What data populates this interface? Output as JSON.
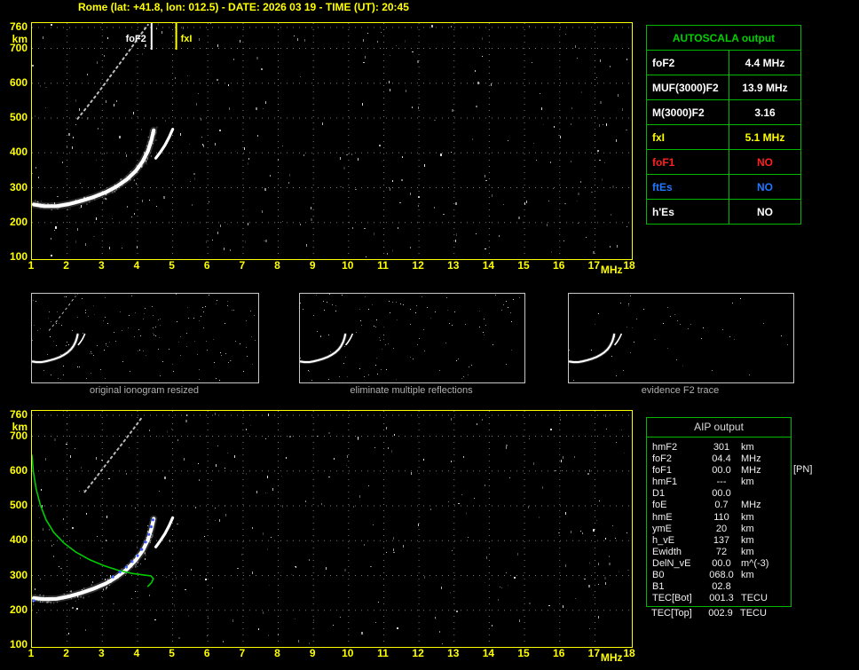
{
  "title": "Rome (lat: +41.8, lon: 012.5) - DATE: 2026 03 19 - TIME (UT): 20:45",
  "colors": {
    "background": "#000000",
    "axis_labels": "#ffff00",
    "plot_border": "#ffff00",
    "grid": "#787878",
    "echo_trace": "#ffffff",
    "profile_curve": "#00cc00",
    "fitted_trace": "#3a5bff",
    "table_border": "#00b800",
    "table_header_green": "#00d000",
    "fxI_yellow": "#ffff00",
    "foF1_red": "#ff2020",
    "ftEs_blue": "#2277ff",
    "caption_gray": "#b0b0b0",
    "thumbnail_border": "#c8c8c8"
  },
  "chart_data": [
    {
      "type": "scatter",
      "title": "autoscaled ionogram",
      "xlabel": "MHz",
      "ylabel": "km",
      "xlim": [
        1,
        18
      ],
      "ylim": [
        100,
        760
      ],
      "xticks": [
        1,
        2,
        3,
        4,
        5,
        6,
        7,
        8,
        9,
        10,
        11,
        12,
        13,
        14,
        15,
        16,
        17,
        18
      ],
      "yticks": [
        760,
        700,
        600,
        500,
        400,
        300,
        200,
        100
      ],
      "grid": true,
      "markers": [
        {
          "label": "foF2",
          "f": 4.4,
          "color": "#ffffff",
          "align": "left"
        },
        {
          "label": "fxI",
          "f": 5.1,
          "color": "#ffff00",
          "align": "right"
        }
      ],
      "series": [
        {
          "name": "F2-trace",
          "style": "thick",
          "color": "#ffffff",
          "points": [
            [
              1.05,
              252
            ],
            [
              1.35,
              247
            ],
            [
              1.7,
              247
            ],
            [
              2.05,
              253
            ],
            [
              2.4,
              262
            ],
            [
              2.75,
              273
            ],
            [
              3.1,
              287
            ],
            [
              3.4,
              303
            ],
            [
              3.7,
              324
            ],
            [
              3.95,
              348
            ],
            [
              4.15,
              376
            ],
            [
              4.3,
              406
            ],
            [
              4.4,
              438
            ],
            [
              4.46,
              465
            ]
          ]
        },
        {
          "name": "x-mode-tail",
          "style": "medium",
          "color": "#ffffff",
          "points": [
            [
              4.52,
              385
            ],
            [
              4.65,
              402
            ],
            [
              4.78,
              422
            ],
            [
              4.9,
              445
            ],
            [
              5.0,
              468
            ]
          ]
        },
        {
          "name": "second-reflection",
          "style": "dotted",
          "color": "#e0e0e0",
          "points": [
            [
              2.3,
              498
            ],
            [
              2.55,
              530
            ],
            [
              2.8,
              562
            ],
            [
              3.05,
              596
            ],
            [
              3.3,
              630
            ],
            [
              3.55,
              664
            ],
            [
              3.8,
              698
            ],
            [
              4.0,
              727
            ],
            [
              4.18,
              752
            ],
            [
              4.3,
              768
            ]
          ]
        }
      ],
      "noise": {
        "count": 260,
        "seed": 12345
      }
    },
    {
      "type": "scatter",
      "title": "ionogram with AIP electron density profile",
      "xlabel": "MHz",
      "ylabel": "km",
      "xlim": [
        1,
        18
      ],
      "ylim": [
        100,
        760
      ],
      "xticks": [
        1,
        2,
        3,
        4,
        5,
        6,
        7,
        8,
        9,
        10,
        11,
        12,
        13,
        14,
        15,
        16,
        17,
        18
      ],
      "yticks": [
        760,
        700,
        600,
        500,
        400,
        300,
        200,
        100
      ],
      "grid": true,
      "markers": [],
      "series": [
        {
          "name": "F2-trace",
          "style": "thick",
          "color": "#ffffff",
          "points": [
            [
              1.05,
              235
            ],
            [
              1.35,
              232
            ],
            [
              1.7,
              233
            ],
            [
              2.05,
              240
            ],
            [
              2.4,
              250
            ],
            [
              2.75,
              262
            ],
            [
              3.1,
              277
            ],
            [
              3.4,
              295
            ],
            [
              3.7,
              318
            ],
            [
              3.95,
              344
            ],
            [
              4.15,
              372
            ],
            [
              4.3,
              403
            ],
            [
              4.4,
              436
            ],
            [
              4.46,
              463
            ]
          ]
        },
        {
          "name": "x-mode-tail",
          "style": "medium",
          "color": "#ffffff",
          "points": [
            [
              4.52,
              382
            ],
            [
              4.65,
              400
            ],
            [
              4.78,
              420
            ],
            [
              4.9,
              443
            ],
            [
              5.0,
              466
            ]
          ]
        },
        {
          "name": "second-reflection",
          "style": "dotted",
          "color": "#d8d8d8",
          "points": [
            [
              2.5,
              540
            ],
            [
              2.75,
              572
            ],
            [
              3.0,
              605
            ],
            [
              3.25,
              638
            ],
            [
              3.5,
              670
            ],
            [
              3.75,
              703
            ],
            [
              3.95,
              730
            ],
            [
              4.12,
              753
            ]
          ]
        },
        {
          "name": "electron-density-profile",
          "style": "line",
          "color": "#00cc00",
          "points": [
            [
              1.0,
              645
            ],
            [
              1.04,
              598
            ],
            [
              1.12,
              548
            ],
            [
              1.24,
              502
            ],
            [
              1.4,
              460
            ],
            [
              1.62,
              424
            ],
            [
              1.9,
              394
            ],
            [
              2.25,
              367
            ],
            [
              2.65,
              345
            ],
            [
              3.05,
              328
            ],
            [
              3.45,
              315
            ],
            [
              3.85,
              306
            ],
            [
              4.2,
              301
            ],
            [
              4.38,
              299
            ],
            [
              4.45,
              291
            ],
            [
              4.4,
              280
            ],
            [
              4.3,
              269
            ]
          ]
        },
        {
          "name": "fitted-F2-trace",
          "style": "dots",
          "color": "#3a5bff",
          "points": [
            [
              1.05,
              228
            ],
            [
              3.3,
              296
            ],
            [
              3.5,
              310
            ],
            [
              3.68,
              324
            ],
            [
              3.85,
              340
            ],
            [
              4.0,
              357
            ],
            [
              4.12,
              375
            ],
            [
              4.23,
              396
            ],
            [
              4.32,
              418
            ],
            [
              4.39,
              440
            ],
            [
              4.44,
              460
            ]
          ]
        }
      ],
      "noise": {
        "count": 260,
        "seed": 67890
      }
    }
  ],
  "thumbnails": [
    {
      "caption": "original ionogram resized",
      "series": [
        "F2-trace",
        "x-mode-tail",
        "second-reflection"
      ],
      "noise": 150
    },
    {
      "caption": "eliminate multiple reflections",
      "series": [
        "F2-trace",
        "x-mode-tail"
      ],
      "noise": 110
    },
    {
      "caption": "evidence F2 trace",
      "series": [
        "F2-trace",
        "x-mode-tail"
      ],
      "noise": 45
    }
  ],
  "autoscala_table": {
    "header": "AUTOSCALA output",
    "rows": [
      {
        "label": "foF2",
        "value": "4.4 MHz",
        "color": "#ffffff"
      },
      {
        "label": "MUF(3000)F2",
        "value": "13.9 MHz",
        "color": "#ffffff"
      },
      {
        "label": "M(3000)F2",
        "value": "3.16",
        "color": "#ffffff"
      },
      {
        "label": "fxI",
        "value": "5.1 MHz",
        "color": "#ffff00"
      },
      {
        "label": "foF1",
        "value": "NO",
        "color": "#ff2020"
      },
      {
        "label": "ftEs",
        "value": "NO",
        "color": "#2277ff"
      },
      {
        "label": "h'Es",
        "value": "NO",
        "color": "#ffffff"
      }
    ]
  },
  "aip_table": {
    "header": "AIP output",
    "rows": [
      {
        "label": "hmF2",
        "value": "301",
        "unit": "km"
      },
      {
        "label": "foF2",
        "value": "04.4",
        "unit": "MHz"
      },
      {
        "label": "foF1",
        "value": "00.0",
        "unit": "MHz",
        "note": "[PN]"
      },
      {
        "label": "hmF1",
        "value": "---",
        "unit": "km"
      },
      {
        "label": "D1",
        "value": "00.0",
        "unit": ""
      },
      {
        "label": "foE",
        "value": "0.7",
        "unit": "MHz"
      },
      {
        "label": "hmE",
        "value": "110",
        "unit": "km"
      },
      {
        "label": "ymE",
        "value": "20",
        "unit": "km"
      },
      {
        "label": "h_vE",
        "value": "137",
        "unit": "km"
      },
      {
        "label": "Ewidth",
        "value": "72",
        "unit": "km"
      },
      {
        "label": "DelN_vE",
        "value": "00.0",
        "unit": "m^(-3)"
      },
      {
        "label": "B0",
        "value": "068.0",
        "unit": "km"
      },
      {
        "label": "B1",
        "value": "02.8",
        "unit": ""
      },
      {
        "label": "TEC[Bot]",
        "value": "001.3",
        "unit": "TECU"
      }
    ],
    "outside_row": {
      "label": "TEC[Top]",
      "value": "002.9",
      "unit": "TECU"
    }
  }
}
